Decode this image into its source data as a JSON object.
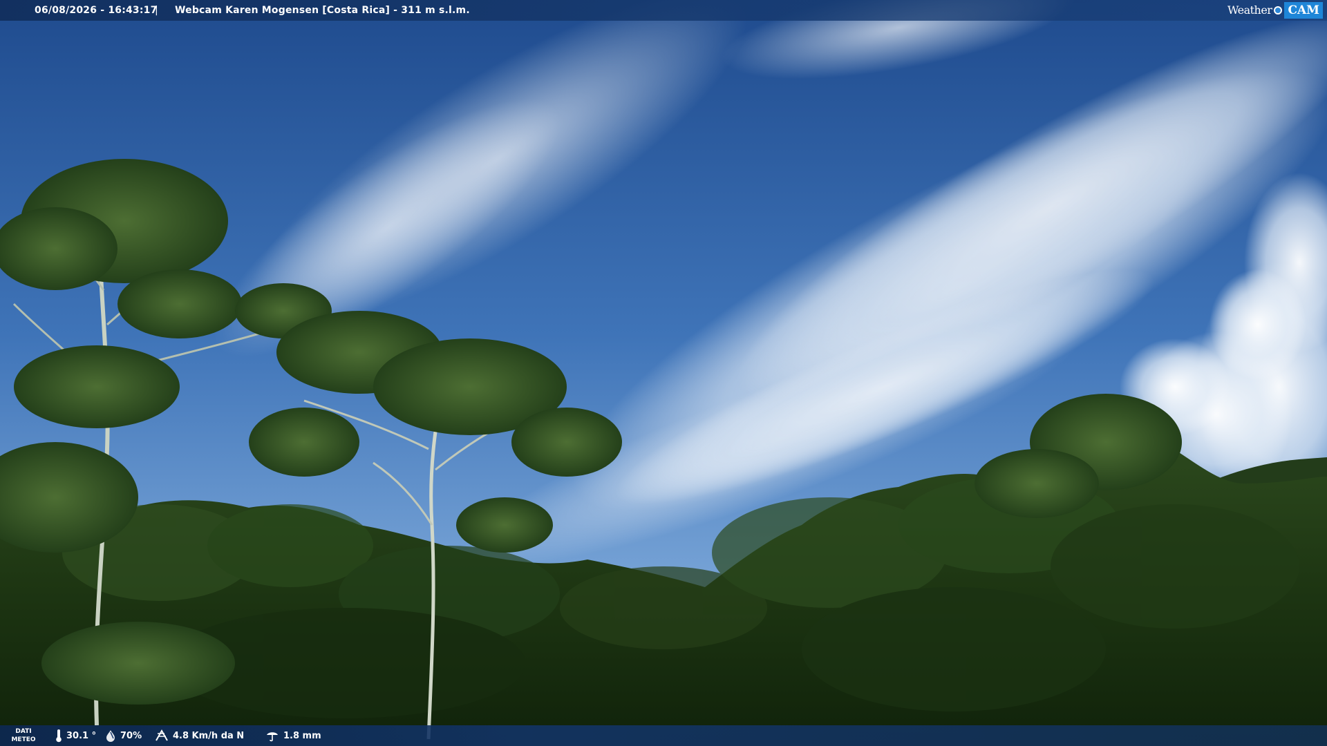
{
  "header": {
    "timestamp": "06/08/2026 - 16:43:17",
    "separator": "|",
    "title": "Webcam Karen Mogensen [Costa Rica] - 311 m s.l.m."
  },
  "brand": {
    "word": "Weather",
    "badge": "CAM"
  },
  "footer": {
    "dati_label": [
      "DATI",
      "METEO"
    ],
    "temperature": "30.1 °",
    "humidity": "70%",
    "wind": "4.8 Km/h da N",
    "rain": "1.8 mm"
  },
  "icons": {
    "temperature": "thermometer-icon",
    "humidity": "drop-icon",
    "wind": "wind-icon",
    "rain": "rain-gauge-icon"
  },
  "colors": {
    "sky_top": "#1e4c8f",
    "sky_bottom": "#6f9fd6",
    "forest": "#17300f",
    "bar": "#123468",
    "brand_accent": "#1f86d8"
  }
}
